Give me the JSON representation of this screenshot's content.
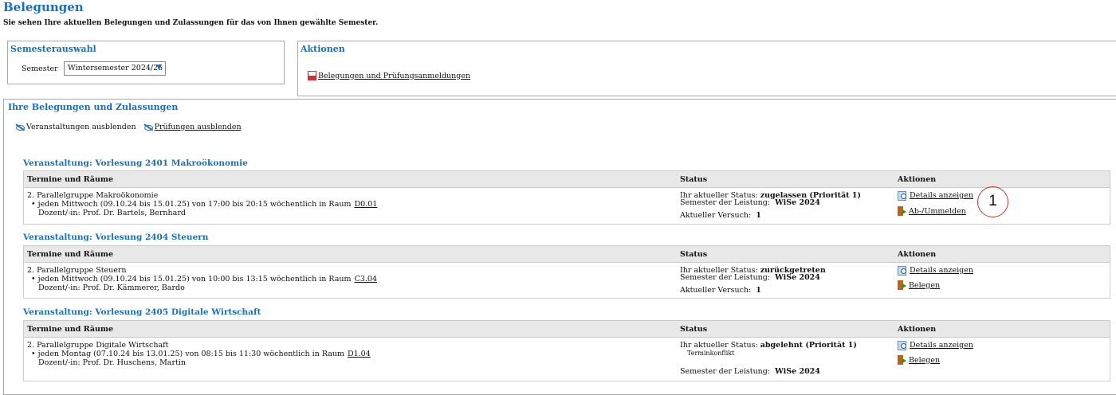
{
  "page": {
    "title": "Belegungen",
    "subtitle": "Sie sehen Ihre aktuellen Belegungen und Zulassungen für das von Ihnen gewählte Semester."
  },
  "semester_box": {
    "title": "Semesterauswahl",
    "label": "Semester",
    "selected": "Wintersemester 2024/25",
    "chevron_icon": "chevron-down-icon"
  },
  "actions_box": {
    "title": "Aktionen",
    "link_label": "Belegungen und Prüfungsanmeldungen",
    "link_icon": "pdf-icon"
  },
  "main": {
    "title": "Ihre Belegungen und Zulassungen",
    "toggle_courses": "Veranstaltungen ausblenden",
    "toggle_exams": "Prüfungen ausblenden"
  },
  "table_headers": {
    "col1": "Termine und Räume",
    "col2": "Status",
    "col3": "Aktionen"
  },
  "courses": [
    {
      "title": "Veranstaltung: Vorlesung 2401 Makroökonomie",
      "group": "2. Parallelgruppe Makroökonomie",
      "schedule": "jeden Mittwoch (09.10.24 bis 15.01.25) von 17:00 bis 20:15 wöchentlich in Raum",
      "room": "D0.01",
      "lecturer": "Dozent/-in: Prof. Dr. Bartels, Bernhard",
      "status_prefix": "Ihr aktueller Status:",
      "status_value": "zugelassen (Priorität 1)",
      "semester_prefix": "Semester der Leistung:",
      "semester_value": "WiSe 2024",
      "attempt_prefix": "Aktueller Versuch:",
      "attempt_value": "1",
      "action_details": "Details anzeigen",
      "action_second": "Ab-/Ummelden"
    },
    {
      "title": "Veranstaltung: Vorlesung 2404 Steuern",
      "group": "2. Parallelgruppe Steuern",
      "schedule": "jeden Mittwoch (09.10.24 bis 15.01.25) von 10:00 bis 13:15 wöchentlich in Raum",
      "room": "C3.04",
      "lecturer": "Dozent/-in: Prof. Dr. Kämmerer, Bardo",
      "status_prefix": "Ihr aktueller Status:",
      "status_value": "zurückgetreten",
      "semester_prefix": "Semester der Leistung:",
      "semester_value": "WiSe 2024",
      "attempt_prefix": "Aktueller Versuch:",
      "attempt_value": "1",
      "action_details": "Details anzeigen",
      "action_second": "Belegen"
    },
    {
      "title": "Veranstaltung: Vorlesung 2405 Digitale Wirtschaft",
      "group": "2. Parallelgruppe Digitale Wirtschaft",
      "schedule": "jeden Montag (07.10.24 bis 13.01.25) von 08:15 bis 11:30 wöchentlich in Raum",
      "room": "D1.04",
      "lecturer": "Dozent/-in: Prof. Dr. Huschens, Martin",
      "status_prefix": "Ihr aktueller Status:",
      "status_value": "abgelehnt (Priorität 1)",
      "status_note": "Terminkonflikt",
      "semester_prefix": "Semester der Leistung:",
      "semester_value": "WiSe 2024",
      "action_details": "Details anzeigen",
      "action_second": "Belegen"
    }
  ],
  "callout": "1"
}
